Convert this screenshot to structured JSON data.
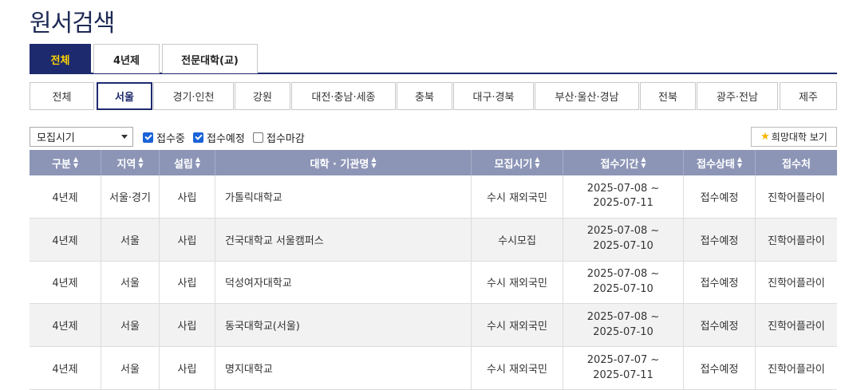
{
  "page": {
    "title": "원서검색"
  },
  "type_tabs": [
    {
      "label": "전체",
      "active": true
    },
    {
      "label": "4년제",
      "active": false
    },
    {
      "label": "전문대학(교)",
      "active": false
    }
  ],
  "region_tabs": [
    {
      "label": "전체",
      "active": false
    },
    {
      "label": "서울",
      "active": true
    },
    {
      "label": "경기·인천",
      "active": false
    },
    {
      "label": "강원",
      "active": false
    },
    {
      "label": "대전·충남·세종",
      "active": false
    },
    {
      "label": "충북",
      "active": false
    },
    {
      "label": "대구·경북",
      "active": false
    },
    {
      "label": "부산·울산·경남",
      "active": false
    },
    {
      "label": "전북",
      "active": false
    },
    {
      "label": "광주·전남",
      "active": false
    },
    {
      "label": "제주",
      "active": false
    }
  ],
  "filters": {
    "period_select": "모집시기",
    "checkboxes": [
      {
        "label": "접수중",
        "checked": true
      },
      {
        "label": "접수예정",
        "checked": true
      },
      {
        "label": "접수마감",
        "checked": false
      }
    ],
    "wish_button": "희망대학 보기"
  },
  "table": {
    "headers": [
      "구분",
      "지역",
      "설립",
      "대학 · 기관명",
      "모집시기",
      "접수기간",
      "접수상태",
      "접수처"
    ],
    "sortable": [
      true,
      true,
      true,
      true,
      true,
      true,
      true,
      false
    ],
    "rows": [
      {
        "type": "4년제",
        "region": "서울·경기",
        "found": "사립",
        "name": "가톨릭대학교",
        "period": "수시 재외국민",
        "start": "2025-07-08 ~",
        "end": "2025-07-11",
        "status": "접수예정",
        "agency": "진학어플라이"
      },
      {
        "type": "4년제",
        "region": "서울",
        "found": "사립",
        "name": "건국대학교 서울캠퍼스",
        "period": "수시모집",
        "start": "2025-07-08 ~",
        "end": "2025-07-10",
        "status": "접수예정",
        "agency": "진학어플라이"
      },
      {
        "type": "4년제",
        "region": "서울",
        "found": "사립",
        "name": "덕성여자대학교",
        "period": "수시 재외국민",
        "start": "2025-07-08 ~",
        "end": "2025-07-10",
        "status": "접수예정",
        "agency": "진학어플라이"
      },
      {
        "type": "4년제",
        "region": "서울",
        "found": "사립",
        "name": "동국대학교(서울)",
        "period": "수시 재외국민",
        "start": "2025-07-08 ~",
        "end": "2025-07-10",
        "status": "접수예정",
        "agency": "진학어플라이"
      },
      {
        "type": "4년제",
        "region": "서울",
        "found": "사립",
        "name": "명지대학교",
        "period": "수시 재외국민",
        "start": "2025-07-07 ~",
        "end": "2025-07-11",
        "status": "접수예정",
        "agency": "진학어플라이"
      }
    ]
  },
  "colors": {
    "primary": "#1e2a6e",
    "accent_yellow": "#ffd400",
    "header_bg": "#8c95b6",
    "checkbox": "#1a63d8"
  }
}
